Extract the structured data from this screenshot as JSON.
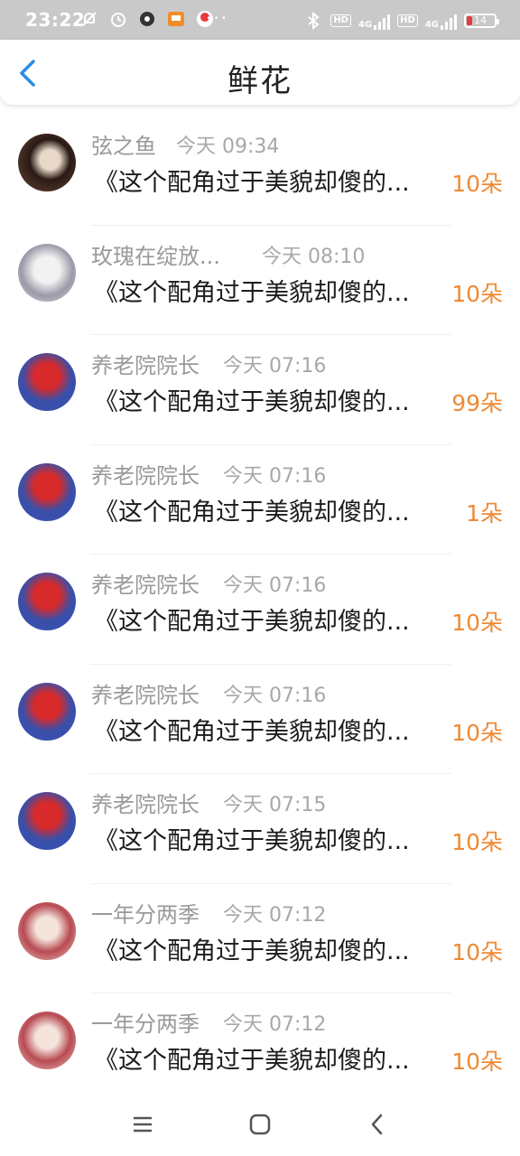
{
  "status_bar": {
    "time": "23:22",
    "signal_1_label": "4G",
    "signal_2_label": "4G",
    "hd_1": "HD",
    "hd_2": "HD",
    "battery": "14",
    "more": "···"
  },
  "header": {
    "title": "鲜花",
    "back_icon": "chevron-left-icon"
  },
  "accent_color": "#ef8a34",
  "items": [
    {
      "name": "弦之鱼",
      "time": "今天 09:34",
      "book": "《这个配角过于美貌却傻的...",
      "flowers": "10朵",
      "avatar": "dark"
    },
    {
      "name": "玫瑰在绽放...",
      "time": "今天 08:10",
      "book": "《这个配角过于美貌却傻的...",
      "flowers": "10朵",
      "avatar": "grey"
    },
    {
      "name": "养老院院长",
      "time": "今天 07:16",
      "book": "《这个配角过于美貌却傻的...",
      "flowers": "99朵",
      "avatar": "red"
    },
    {
      "name": "养老院院长",
      "time": "今天 07:16",
      "book": "《这个配角过于美貌却傻的...",
      "flowers": "1朵",
      "avatar": "red"
    },
    {
      "name": "养老院院长",
      "time": "今天 07:16",
      "book": "《这个配角过于美貌却傻的...",
      "flowers": "10朵",
      "avatar": "red"
    },
    {
      "name": "养老院院长",
      "time": "今天 07:16",
      "book": "《这个配角过于美貌却傻的...",
      "flowers": "10朵",
      "avatar": "red"
    },
    {
      "name": "养老院院长",
      "time": "今天 07:15",
      "book": "《这个配角过于美貌却傻的...",
      "flowers": "10朵",
      "avatar": "red"
    },
    {
      "name": "一年分两季",
      "time": "今天 07:12",
      "book": "《这个配角过于美貌却傻的...",
      "flowers": "10朵",
      "avatar": "rose"
    },
    {
      "name": "一年分两季",
      "time": "今天 07:12",
      "book": "《这个配角过于美貌却傻的...",
      "flowers": "10朵",
      "avatar": "rose"
    }
  ],
  "bottom_nav": {
    "menu_icon": "menu-icon",
    "home_icon": "home-icon",
    "back_icon": "back-icon"
  }
}
